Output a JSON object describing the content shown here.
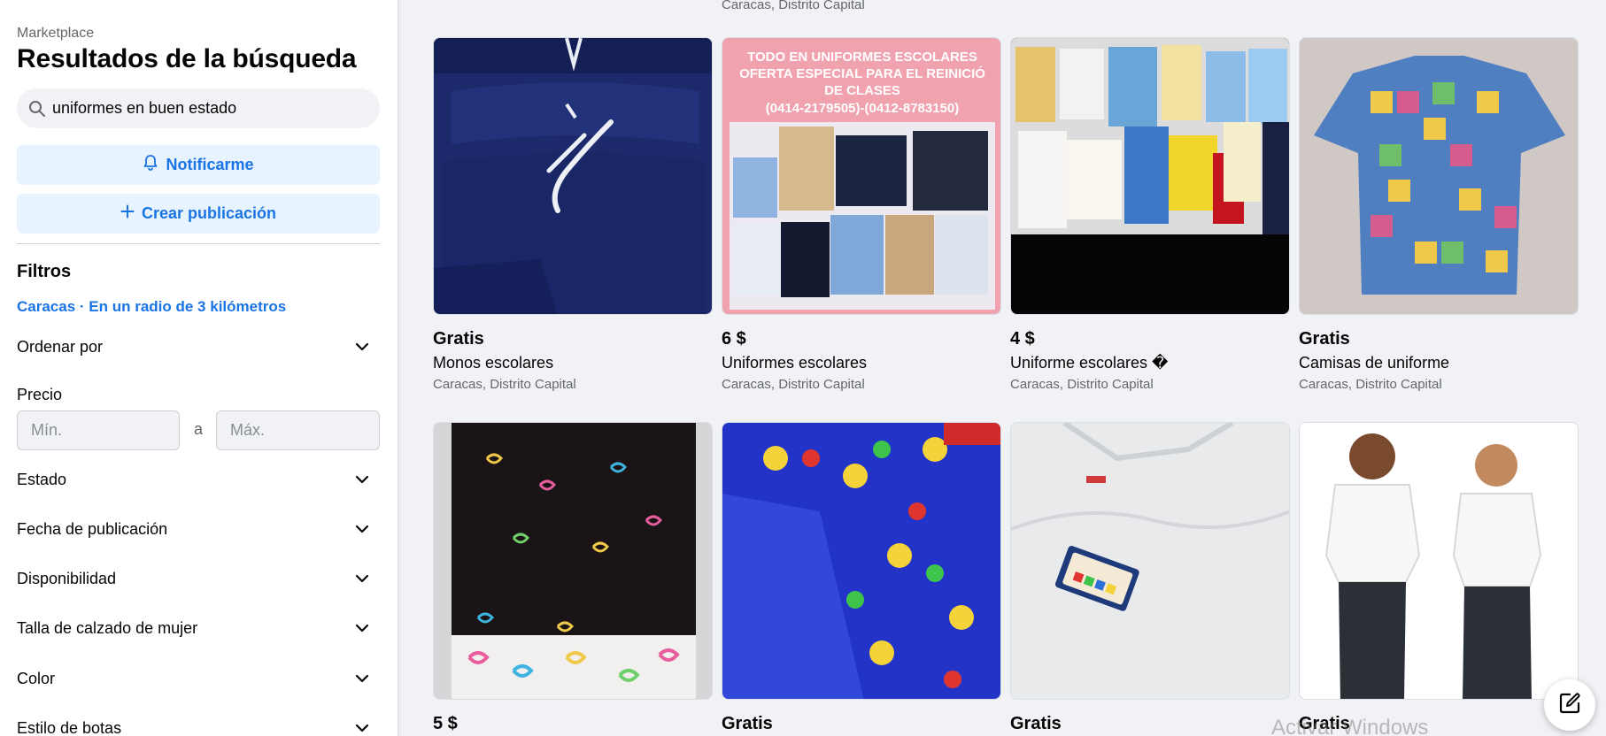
{
  "sidebar": {
    "breadcrumb": "Marketplace",
    "title": "Resultados de la búsqueda",
    "search": {
      "value": "uniformes en buen estado",
      "icon": "search-icon"
    },
    "notify_label": "Notificarme",
    "create_label": "Crear publicación",
    "filters_title": "Filtros",
    "location": "Caracas · En un radio de 3 kilómetros",
    "sort_label": "Ordenar por",
    "price_label": "Precio",
    "price_min_placeholder": "Mín.",
    "price_max_placeholder": "Máx.",
    "price_separator": "a",
    "filters": [
      {
        "label": "Estado"
      },
      {
        "label": "Fecha de publicación"
      },
      {
        "label": "Disponibilidad"
      },
      {
        "label": "Talla de calzado de mujer"
      },
      {
        "label": "Color"
      },
      {
        "label": "Estilo de botas"
      }
    ]
  },
  "main": {
    "top_location": "Caracas, Distrito Capital",
    "listings": [
      {
        "price": "Gratis",
        "title": "Monos escolares",
        "location": "Caracas, Distrito Capital"
      },
      {
        "price": "6 $",
        "title": "Uniformes escolares",
        "location": "Caracas, Distrito Capital",
        "banner": [
          "TODO EN UNIFORMES ESCOLARES",
          "OFERTA ESPECIAL PARA EL REINICIÓ",
          "DE CLASES",
          "(0414-2179505)-(0412-8783150)"
        ]
      },
      {
        "price": "4 $",
        "title": "Uniforme escolares �",
        "location": "Caracas, Distrito Capital"
      },
      {
        "price": "Gratis",
        "title": "Camisas de uniforme",
        "location": "Caracas, Distrito Capital"
      },
      {
        "price": "5 $"
      },
      {
        "price": "Gratis"
      },
      {
        "price": "Gratis"
      },
      {
        "price": "Gratis"
      }
    ]
  },
  "watermark": "Activar Windows",
  "colors": {
    "accent": "#1b74e4",
    "accent_bg": "#e7f3ff",
    "page_bg": "#f0f2f5",
    "muted": "#65676b"
  }
}
